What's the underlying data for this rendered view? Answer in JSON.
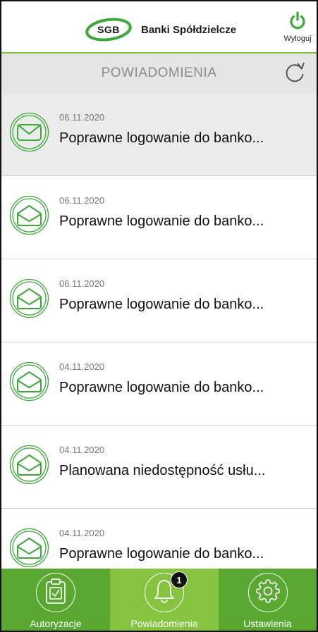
{
  "header": {
    "logo_text": "SGB",
    "brand_name": "Banki Spółdzielcze",
    "logout_label": "Wyloguj"
  },
  "titlebar": {
    "title": "POWIADOMIENIA"
  },
  "notifications": [
    {
      "date": "06.11.2020",
      "text": "Poprawne logowanie do banko...",
      "read": false,
      "selected": true
    },
    {
      "date": "06.11.2020",
      "text": "Poprawne logowanie do banko...",
      "read": true,
      "selected": false
    },
    {
      "date": "06.11.2020",
      "text": "Poprawne logowanie do banko...",
      "read": true,
      "selected": false
    },
    {
      "date": "04.11.2020",
      "text": "Poprawne logowanie do banko...",
      "read": true,
      "selected": false
    },
    {
      "date": "04.11.2020",
      "text": "Planowana niedostępność usłu...",
      "read": true,
      "selected": false
    },
    {
      "date": "04.11.2020",
      "text": "Poprawne logowanie do banko...",
      "read": true,
      "selected": false
    }
  ],
  "bottomnav": {
    "tabs": [
      {
        "label": "Autoryzacje",
        "icon": "clipboard-check-icon",
        "active": false
      },
      {
        "label": "Powiadomienia",
        "icon": "bell-icon",
        "active": true,
        "badge": "1"
      },
      {
        "label": "Ustawienia",
        "icon": "gear-icon",
        "active": false
      }
    ]
  },
  "colors": {
    "brand_green": "#3aa935",
    "nav_green": "#5aa832",
    "nav_active": "#86c440"
  }
}
